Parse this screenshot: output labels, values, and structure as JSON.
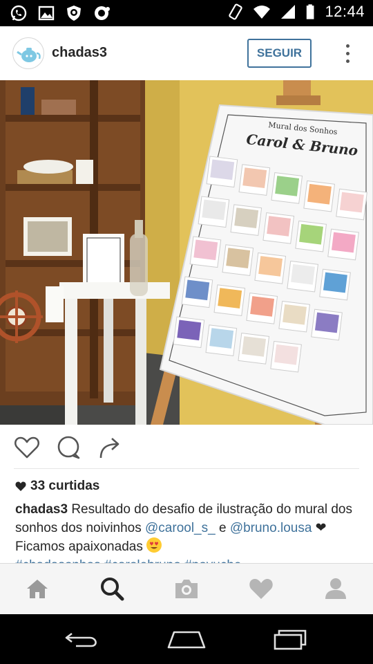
{
  "status_bar": {
    "time": "12:44",
    "left_icons": [
      "whatsapp-icon",
      "gallery-icon",
      "shield-icon",
      "notification-icon"
    ],
    "right_icons": [
      "vibrate-icon",
      "wifi-icon",
      "signal-icon",
      "battery-icon"
    ]
  },
  "post": {
    "username": "chadas3",
    "follow_label": "SEGUIR",
    "image_alt": "Mural dos Sonhos Carol & Bruno",
    "board_title_small": "Mural dos Sonhos",
    "board_title": "Carol & Bruno",
    "likes_label": "33 curtidas",
    "caption": {
      "username": "chadas3",
      "text1": " Resultado do desafio de ilustração do mural dos sonhos dos noivinhos ",
      "mention1": "@carool_s_",
      "text2": " e ",
      "mention2": "@bruno.lousa",
      "text3": " ❤ Ficamos apaixonadas ",
      "hashtags": "#chadasonhos #carolebruno #noyuche"
    }
  },
  "colors": {
    "link": "#3f729b",
    "text": "#262626",
    "nav_bg": "#f5f5f5"
  },
  "bottom_nav": [
    "home-icon",
    "search-icon",
    "camera-icon",
    "heart-icon",
    "profile-icon"
  ],
  "system_nav": [
    "back-icon",
    "home-icon",
    "recents-icon"
  ]
}
